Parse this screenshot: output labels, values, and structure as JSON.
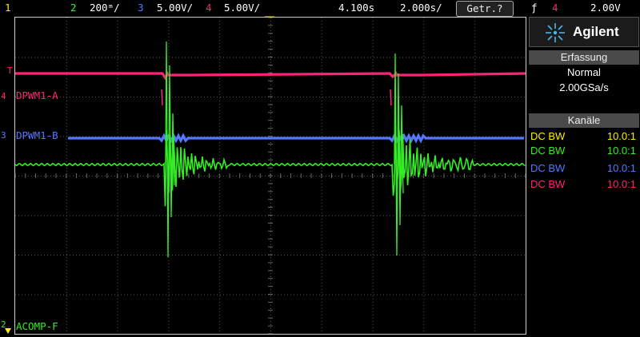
{
  "colors": {
    "ch1": "#ffee00",
    "ch2": "#33ee22",
    "ch3": "#5577ff",
    "ch4": "#ff2277",
    "trig_marker": "#ff9900"
  },
  "topbar": {
    "ch1": {
      "num": "1",
      "value": ""
    },
    "ch2": {
      "num": "2",
      "value": "200ᵐ/"
    },
    "ch3": {
      "num": "3",
      "value": "5.00V/"
    },
    "ch4": {
      "num": "4",
      "value": "5.00V/"
    },
    "delay": "4.100s",
    "timebase": "2.000s/",
    "trigger_mode": "Getr.?",
    "trigger_icon": "ƒ",
    "trigger_channel": "4",
    "trigger_level": "2.00V"
  },
  "channel_labels": {
    "ch4": "DPWM1-A",
    "ch3": "DPWM1-B",
    "ch2": "ACOMP-F"
  },
  "edge_markers": {
    "ch4": "4",
    "ch3": "3",
    "ch2": "2",
    "ch1": "1",
    "trig": "T"
  },
  "panel": {
    "brand": "Agilent",
    "acq_header": "Erfassung",
    "acq_mode": "Normal",
    "sample_rate": "2.00GSa/s",
    "channels_header": "Kanäle",
    "channels": [
      {
        "coupling": "DC BW",
        "probe": "10.0:1",
        "color": "#ffee00"
      },
      {
        "coupling": "DC BW",
        "probe": "10.0:1",
        "color": "#33ee22"
      },
      {
        "coupling": "DC BW",
        "probe": "10.0:1",
        "color": "#5577ff"
      },
      {
        "coupling": "DC BW",
        "probe": "10.0:1",
        "color": "#ff2277"
      }
    ]
  }
}
